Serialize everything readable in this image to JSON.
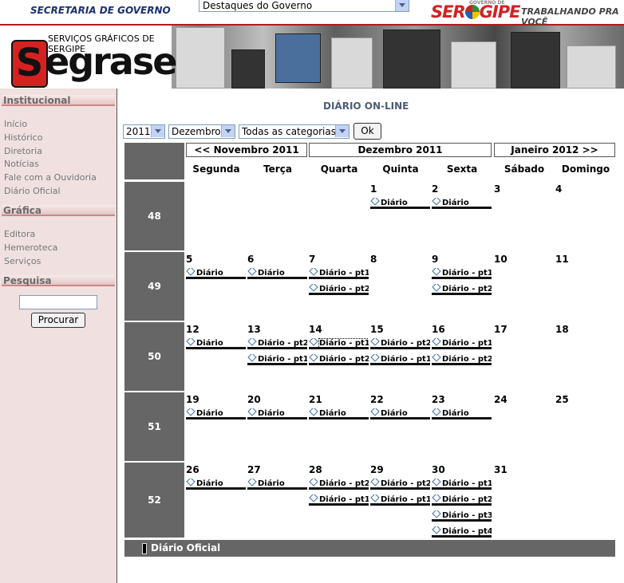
{
  "header": {
    "secretaria": "SECRETARIA DE GOVERNO",
    "destaques_select": "Destaques do Governo",
    "gov_small": "GOVERNO DE",
    "sergipe_left": "SER",
    "sergipe_right": "GIPE",
    "slogan": "TRABALHANDO PRA VOCÊ"
  },
  "banner": {
    "subtitle": "SERVIÇOS GRÁFICOS DE SERGIPE",
    "brand_s": "S",
    "brand_rest": "egrase"
  },
  "sidebar": {
    "institucional": "Institucional",
    "inst_items": [
      "Início",
      "Histórico",
      "Diretoria",
      "Notícias",
      "Fale com a Ouvidoria",
      "Diário Oficial"
    ],
    "grafica": "Gráfica",
    "graf_items": [
      "Editora",
      "Hemeroteca",
      "Serviços"
    ],
    "pesquisa": "Pesquisa",
    "search_value": "",
    "search_button": "Procurar"
  },
  "main": {
    "title": "DIÁRIO ON-LINE",
    "year": "2011",
    "month": "Dezembro",
    "category": "Todas as categorias",
    "ok": "Ok",
    "prev": "<< Novembro 2011",
    "current": "Dezembro 2011",
    "next": "Janeiro 2012 >>",
    "days": [
      "Segunda",
      "Terça",
      "Quarta",
      "Quinta",
      "Sexta",
      "Sábado",
      "Domingo"
    ],
    "weeks": [
      "48",
      "49",
      "50",
      "51",
      "52"
    ],
    "cells": [
      [
        "",
        "",
        "",
        "1",
        "2",
        "3",
        "4"
      ],
      [
        "5",
        "6",
        "7",
        "8",
        "9",
        "10",
        "11"
      ],
      [
        "12",
        "13",
        "14",
        "15",
        "16",
        "17",
        "18"
      ],
      [
        "19",
        "20",
        "21",
        "22",
        "23",
        "24",
        "25"
      ],
      [
        "26",
        "27",
        "28",
        "29",
        "30",
        "31",
        ""
      ]
    ],
    "links": [
      [
        [],
        [],
        [],
        [
          "Diário"
        ],
        [
          "Diário"
        ],
        [],
        []
      ],
      [
        [
          "Diário"
        ],
        [
          "Diário"
        ],
        [
          "Diário - pt1",
          "Diário - pt2"
        ],
        [],
        [
          "Diário - pt1",
          "Diário - pt2"
        ],
        [],
        []
      ],
      [
        [
          "Diário"
        ],
        [
          "Diário - pt2",
          "Diário - pt1"
        ],
        [
          "Diário - pt1",
          "Diário - pt2"
        ],
        [
          "Diário - pt2",
          "Diário - pt1"
        ],
        [
          "Diário - pt1",
          "Diário - pt2"
        ],
        [],
        []
      ],
      [
        [
          "Diário"
        ],
        [
          "Diário"
        ],
        [
          "Diário"
        ],
        [
          "Diário"
        ],
        [
          "Diário"
        ],
        [],
        []
      ],
      [
        [
          "Diário"
        ],
        [
          "Diário"
        ],
        [
          "Diário - pt2",
          "Diário - pt1"
        ],
        [
          "Diário - pt2",
          "Diário - pt1"
        ],
        [
          "Diário - pt1",
          "Diário - pt2",
          "Diário - pt3",
          "Diário - pt4"
        ],
        [],
        []
      ]
    ],
    "footer": "Diário Oficial"
  }
}
